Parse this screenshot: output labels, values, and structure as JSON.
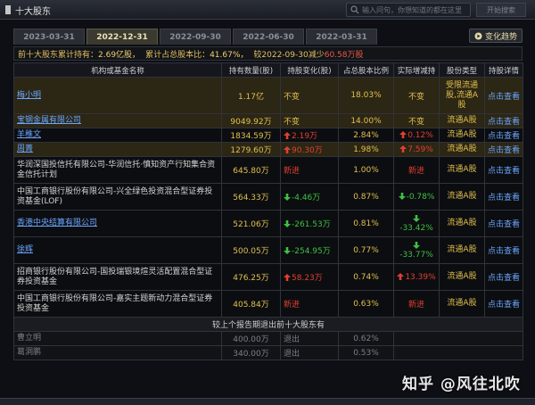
{
  "window": {
    "title": "十大股东"
  },
  "search": {
    "placeholder": "输入问句，你想知道的都在这里",
    "button": "开始搜索"
  },
  "tabs": [
    {
      "label": "2023-03-31",
      "active": false
    },
    {
      "label": "2022-12-31",
      "active": true
    },
    {
      "label": "2022-09-30",
      "active": false
    },
    {
      "label": "2022-06-30",
      "active": false
    },
    {
      "label": "2022-03-31",
      "active": false
    }
  ],
  "trend_button": "变化趋势",
  "summary": {
    "label1": "前十大股东累计持有：",
    "value1": "2.69亿股，",
    "label2": "累计占总股本比：",
    "value2": "41.67%，",
    "compare": "较2022-09-30减少",
    "change": "60.58万股"
  },
  "table": {
    "headers": [
      "机构或基金名称",
      "持有数量(股)",
      "持股变化(股)",
      "占总股本比例",
      "实际增减持",
      "股份类型",
      "持股详情"
    ],
    "rows": [
      {
        "name": "梅小明",
        "link": true,
        "shares": "1.17亿",
        "change": "不变",
        "change_dir": "same",
        "ratio": "18.03%",
        "actual": "不变",
        "actual_dir": "same",
        "type": "受限流通股,流通A股",
        "detail": "点击查看",
        "highlight": true
      },
      {
        "name": "宝钢金属有限公司",
        "link": true,
        "shares": "9049.92万",
        "change": "不变",
        "change_dir": "same",
        "ratio": "14.00%",
        "actual": "不变",
        "actual_dir": "same",
        "type": "流通A股",
        "detail": "点击查看",
        "highlight": true
      },
      {
        "name": "羊稚文",
        "link": true,
        "shares": "1834.59万",
        "change": "2.19万",
        "change_dir": "up",
        "ratio": "2.84%",
        "actual": "0.12%",
        "actual_dir": "up",
        "type": "流通A股",
        "detail": "点击查看",
        "highlight": false
      },
      {
        "name": "周菁",
        "link": true,
        "shares": "1279.60万",
        "change": "90.30万",
        "change_dir": "up",
        "ratio": "1.98%",
        "actual": "7.59%",
        "actual_dir": "up",
        "type": "流通A股",
        "detail": "点击查看",
        "highlight": true
      },
      {
        "name": "华润深国投信托有限公司-华润信托·慎知资产行知集合资金信托计划",
        "link": false,
        "shares": "645.80万",
        "change": "新进",
        "change_dir": "new",
        "ratio": "1.00%",
        "actual": "新进",
        "actual_dir": "new",
        "type": "流通A股",
        "detail": "点击查看",
        "highlight": false
      },
      {
        "name": "中国工商银行股份有限公司-兴全绿色投资混合型证券投资基金(LOF)",
        "link": false,
        "shares": "564.33万",
        "change": "-4.46万",
        "change_dir": "down",
        "ratio": "0.87%",
        "actual": "-0.78%",
        "actual_dir": "down",
        "type": "流通A股",
        "detail": "点击查看",
        "highlight": false
      },
      {
        "name": "香港中央结算有限公司",
        "link": true,
        "shares": "521.06万",
        "change": "-261.53万",
        "change_dir": "down",
        "ratio": "0.81%",
        "actual": "-33.42%",
        "actual_dir": "down",
        "type": "流通A股",
        "detail": "点击查看",
        "highlight": false
      },
      {
        "name": "徐辉",
        "link": true,
        "shares": "500.05万",
        "change": "-254.95万",
        "change_dir": "down",
        "ratio": "0.77%",
        "actual": "-33.77%",
        "actual_dir": "down",
        "type": "流通A股",
        "detail": "点击查看",
        "highlight": false
      },
      {
        "name": "招商银行股份有限公司-国投瑞银境煊灵活配置混合型证券投资基金",
        "link": false,
        "shares": "476.25万",
        "change": "58.23万",
        "change_dir": "up",
        "ratio": "0.74%",
        "actual": "13.39%",
        "actual_dir": "up",
        "type": "流通A股",
        "detail": "点击查看",
        "highlight": false
      },
      {
        "name": "中国工商银行股份有限公司-嘉实主题新动力混合型证券投资基金",
        "link": false,
        "shares": "405.84万",
        "change": "新进",
        "change_dir": "new",
        "ratio": "0.63%",
        "actual": "新进",
        "actual_dir": "new",
        "type": "流通A股",
        "detail": "点击查看",
        "highlight": false
      }
    ],
    "exit_header": "较上个报告期退出前十大股东有",
    "exits": [
      {
        "name": "曹立明",
        "shares": "400.00万",
        "status": "退出",
        "ratio": "0.62%"
      },
      {
        "name": "葛洞鹏",
        "shares": "340.00万",
        "status": "退出",
        "ratio": "0.53%"
      }
    ]
  },
  "watermark": "知乎 @风往北吹",
  "colors": {
    "gold": "#e0c050",
    "red": "#e04030",
    "green": "#3ec044",
    "link": "#6aa6ff"
  }
}
